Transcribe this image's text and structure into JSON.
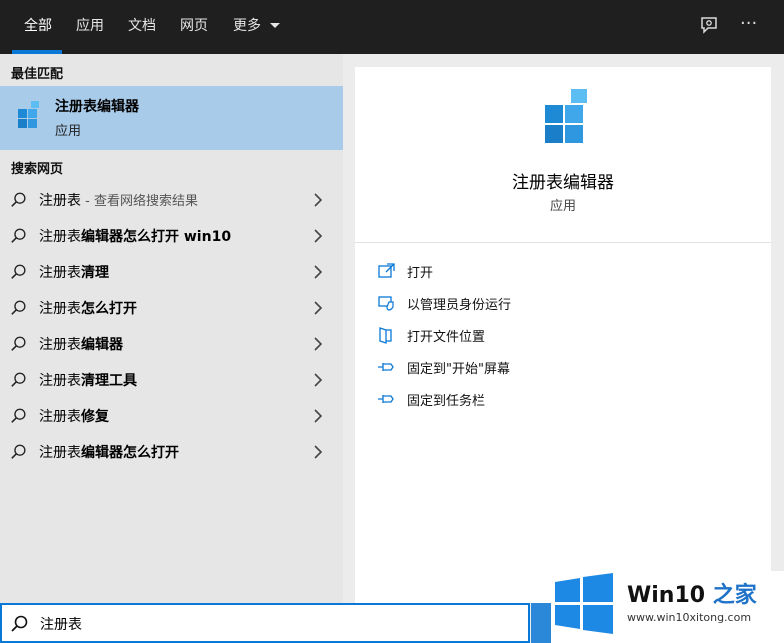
{
  "tabs": [
    {
      "label": "全部",
      "active": true
    },
    {
      "label": "应用",
      "active": false
    },
    {
      "label": "文档",
      "active": false
    },
    {
      "label": "网页",
      "active": false
    },
    {
      "label": "更多",
      "active": false
    }
  ],
  "top_icons": [
    "feedback-icon",
    "more-options-icon"
  ],
  "top_more_glyph": "···",
  "best_match": {
    "section_title": "最佳匹配",
    "name": "注册表编辑器",
    "type": "应用",
    "icon": "registry-editor-icon"
  },
  "web_search": {
    "section_title": "搜索网页",
    "items": [
      {
        "prefix": "注册表",
        "bold": "",
        "sub": " - 查看网络搜索结果"
      },
      {
        "prefix": "注册表",
        "bold": "编辑器怎么打开 win10",
        "sub": ""
      },
      {
        "prefix": "注册表",
        "bold": "清理",
        "sub": ""
      },
      {
        "prefix": "注册表",
        "bold": "怎么打开",
        "sub": ""
      },
      {
        "prefix": "注册表",
        "bold": "编辑器",
        "sub": ""
      },
      {
        "prefix": "注册表",
        "bold": "清理工具",
        "sub": ""
      },
      {
        "prefix": "注册表",
        "bold": "修复",
        "sub": ""
      },
      {
        "prefix": "注册表",
        "bold": "编辑器怎么打开",
        "sub": ""
      }
    ]
  },
  "detail": {
    "title": "注册表编辑器",
    "subtitle": "应用",
    "actions": [
      {
        "label": "打开",
        "icon": "open-icon"
      },
      {
        "label": "以管理员身份运行",
        "icon": "run-as-admin-icon"
      },
      {
        "label": "打开文件位置",
        "icon": "file-location-icon"
      },
      {
        "label": "固定到\"开始\"屏幕",
        "icon": "pin-icon"
      },
      {
        "label": "固定到任务栏",
        "icon": "pin-icon"
      }
    ]
  },
  "search": {
    "value": "注册表"
  },
  "watermark": {
    "title_a": "Win10",
    "title_b": " 之家",
    "url": "www.win10xitong.com"
  },
  "colors": {
    "accent": "#0a78d7",
    "selected": "#a8cbea",
    "topbar": "#1f1f1f",
    "panel": "#e6e6e6"
  }
}
